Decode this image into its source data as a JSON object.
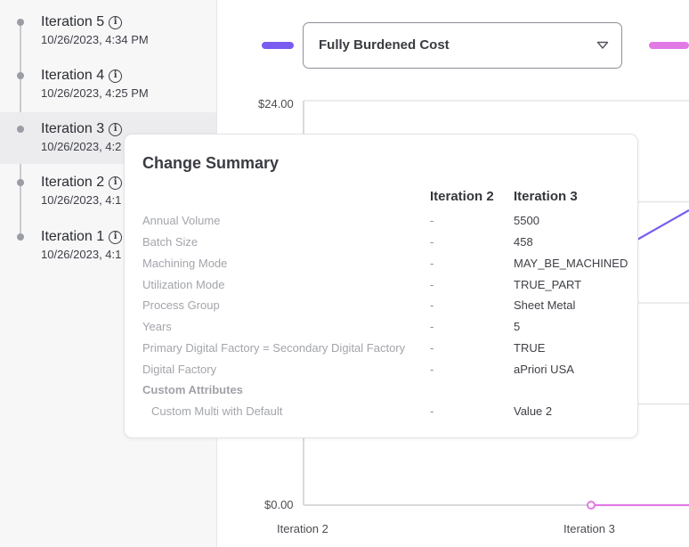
{
  "iterations": [
    {
      "name": "Iteration 5",
      "date": "10/26/2023, 4:34 PM"
    },
    {
      "name": "Iteration 4",
      "date": "10/26/2023, 4:25 PM"
    },
    {
      "name": "Iteration 3",
      "date": "10/26/2023, 4:2"
    },
    {
      "name": "Iteration 2",
      "date": "10/26/2023, 4:1"
    },
    {
      "name": "Iteration 1",
      "date": "10/26/2023, 4:1"
    }
  ],
  "metric_select": {
    "value": "Fully Burdened Cost"
  },
  "legend": {
    "left_color": "#7b5cf0",
    "right_color": "#e27ae6"
  },
  "chart_data": {
    "type": "line",
    "y_tick_labels": [
      "$24.00",
      "$0.00"
    ],
    "x_tick_labels": [
      "Iteration 2",
      "Iteration 3"
    ],
    "ylim": [
      0,
      24
    ],
    "series": [
      {
        "color": "#7b5cf0"
      },
      {
        "color": "#e27ae6"
      }
    ]
  },
  "change_summary": {
    "title": "Change Summary",
    "col_a": "Iteration 2",
    "col_b": "Iteration 3",
    "rows": [
      {
        "key": "Annual Volume",
        "a": "-",
        "b": "5500"
      },
      {
        "key": "Batch Size",
        "a": "-",
        "b": "458"
      },
      {
        "key": "Machining Mode",
        "a": "-",
        "b": "MAY_BE_MACHINED"
      },
      {
        "key": "Utilization Mode",
        "a": "-",
        "b": "TRUE_PART"
      },
      {
        "key": "Process Group",
        "a": "-",
        "b": "Sheet Metal"
      },
      {
        "key": "Years",
        "a": "-",
        "b": "5"
      },
      {
        "key": "Primary Digital Factory = Secondary Digital Factory",
        "a": "-",
        "b": "TRUE"
      },
      {
        "key": "Digital Factory",
        "a": "-",
        "b": "aPriori USA"
      }
    ],
    "section": "Custom Attributes",
    "custom_rows": [
      {
        "key": "Custom Multi with Default",
        "a": "-",
        "b": "Value 2"
      }
    ]
  }
}
